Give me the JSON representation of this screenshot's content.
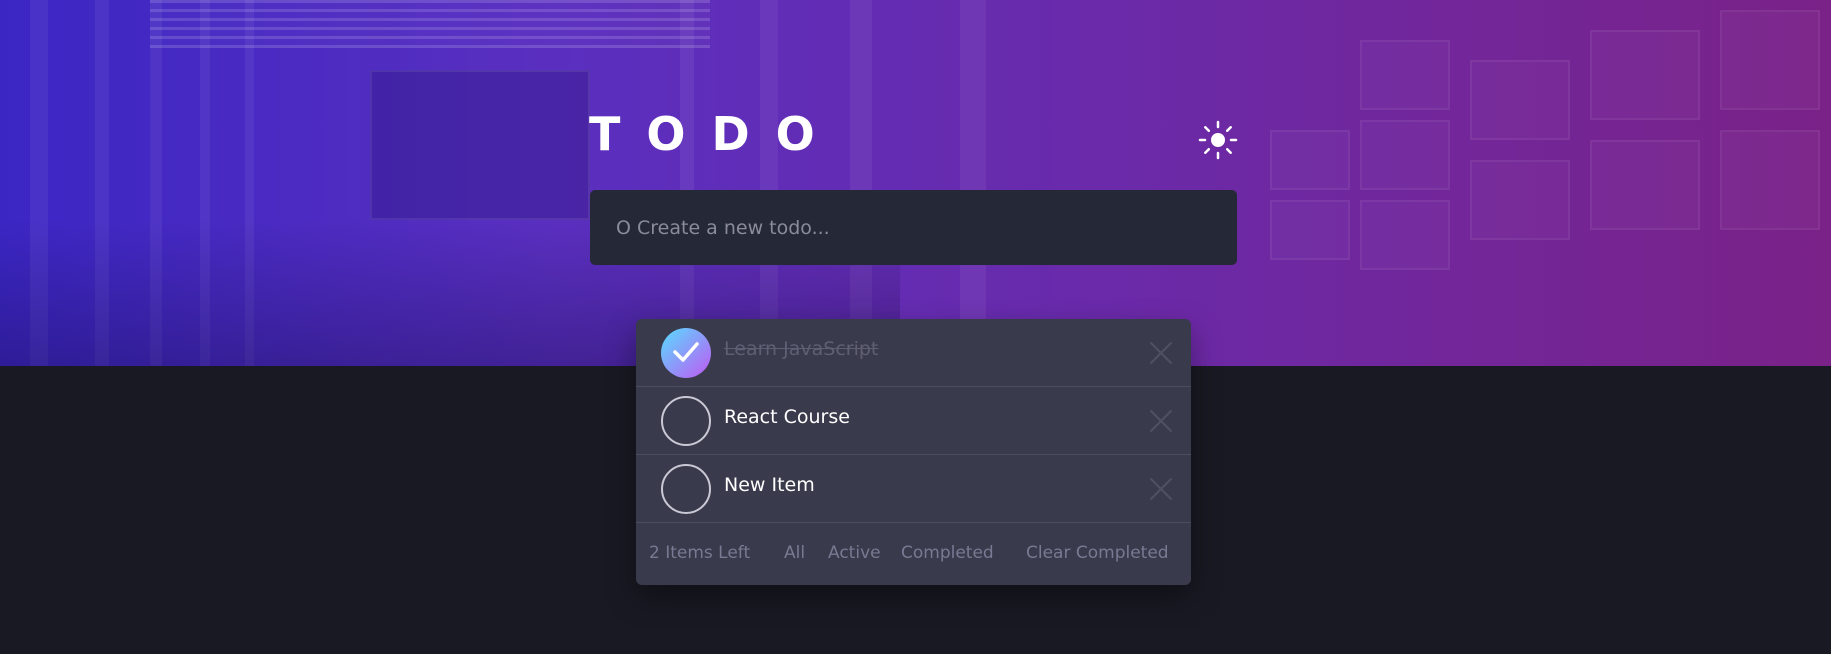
{
  "app": {
    "title": "TODO"
  },
  "new_todo": {
    "placeholder": "O Create a new todo..."
  },
  "todos": [
    {
      "label": "Learn JavaScript",
      "completed": true
    },
    {
      "label": "React Course",
      "completed": false
    },
    {
      "label": "New Item",
      "completed": false
    }
  ],
  "footer": {
    "items_left": "2 Items Left",
    "filter_all": "All",
    "filter_active": "Active",
    "filter_completed": "Completed",
    "clear_completed": "Clear Completed"
  },
  "icons": {
    "theme_toggle": "sun-icon",
    "check": "check-icon",
    "delete": "cross-icon"
  },
  "colors": {
    "check_gradient_start": "#57ddff",
    "check_gradient_end": "#c058f3",
    "background": "#181922",
    "card": "#393a4b"
  }
}
